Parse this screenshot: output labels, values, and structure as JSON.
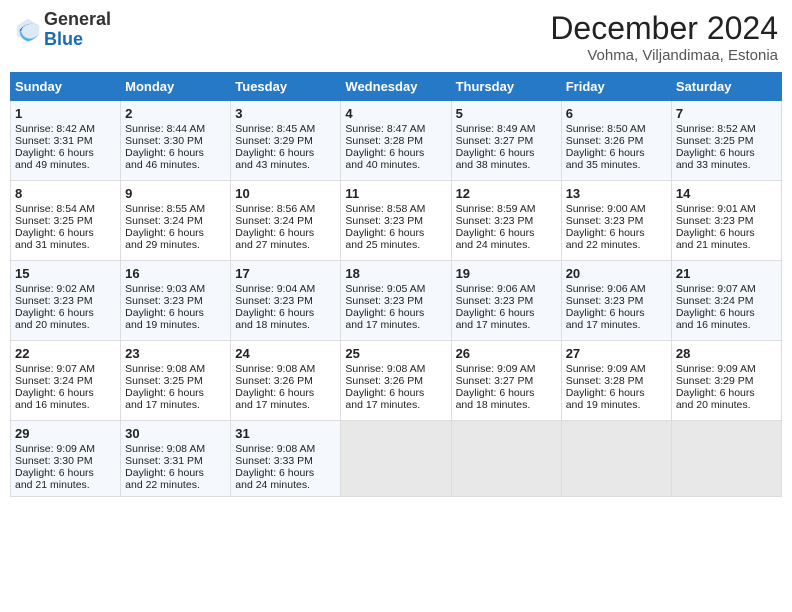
{
  "header": {
    "logo_general": "General",
    "logo_blue": "Blue",
    "month_title": "December 2024",
    "subtitle": "Vohma, Viljandimaa, Estonia"
  },
  "days_of_week": [
    "Sunday",
    "Monday",
    "Tuesday",
    "Wednesday",
    "Thursday",
    "Friday",
    "Saturday"
  ],
  "weeks": [
    [
      {
        "day": 1,
        "lines": [
          "Sunrise: 8:42 AM",
          "Sunset: 3:31 PM",
          "Daylight: 6 hours",
          "and 49 minutes."
        ]
      },
      {
        "day": 2,
        "lines": [
          "Sunrise: 8:44 AM",
          "Sunset: 3:30 PM",
          "Daylight: 6 hours",
          "and 46 minutes."
        ]
      },
      {
        "day": 3,
        "lines": [
          "Sunrise: 8:45 AM",
          "Sunset: 3:29 PM",
          "Daylight: 6 hours",
          "and 43 minutes."
        ]
      },
      {
        "day": 4,
        "lines": [
          "Sunrise: 8:47 AM",
          "Sunset: 3:28 PM",
          "Daylight: 6 hours",
          "and 40 minutes."
        ]
      },
      {
        "day": 5,
        "lines": [
          "Sunrise: 8:49 AM",
          "Sunset: 3:27 PM",
          "Daylight: 6 hours",
          "and 38 minutes."
        ]
      },
      {
        "day": 6,
        "lines": [
          "Sunrise: 8:50 AM",
          "Sunset: 3:26 PM",
          "Daylight: 6 hours",
          "and 35 minutes."
        ]
      },
      {
        "day": 7,
        "lines": [
          "Sunrise: 8:52 AM",
          "Sunset: 3:25 PM",
          "Daylight: 6 hours",
          "and 33 minutes."
        ]
      }
    ],
    [
      {
        "day": 8,
        "lines": [
          "Sunrise: 8:54 AM",
          "Sunset: 3:25 PM",
          "Daylight: 6 hours",
          "and 31 minutes."
        ]
      },
      {
        "day": 9,
        "lines": [
          "Sunrise: 8:55 AM",
          "Sunset: 3:24 PM",
          "Daylight: 6 hours",
          "and 29 minutes."
        ]
      },
      {
        "day": 10,
        "lines": [
          "Sunrise: 8:56 AM",
          "Sunset: 3:24 PM",
          "Daylight: 6 hours",
          "and 27 minutes."
        ]
      },
      {
        "day": 11,
        "lines": [
          "Sunrise: 8:58 AM",
          "Sunset: 3:23 PM",
          "Daylight: 6 hours",
          "and 25 minutes."
        ]
      },
      {
        "day": 12,
        "lines": [
          "Sunrise: 8:59 AM",
          "Sunset: 3:23 PM",
          "Daylight: 6 hours",
          "and 24 minutes."
        ]
      },
      {
        "day": 13,
        "lines": [
          "Sunrise: 9:00 AM",
          "Sunset: 3:23 PM",
          "Daylight: 6 hours",
          "and 22 minutes."
        ]
      },
      {
        "day": 14,
        "lines": [
          "Sunrise: 9:01 AM",
          "Sunset: 3:23 PM",
          "Daylight: 6 hours",
          "and 21 minutes."
        ]
      }
    ],
    [
      {
        "day": 15,
        "lines": [
          "Sunrise: 9:02 AM",
          "Sunset: 3:23 PM",
          "Daylight: 6 hours",
          "and 20 minutes."
        ]
      },
      {
        "day": 16,
        "lines": [
          "Sunrise: 9:03 AM",
          "Sunset: 3:23 PM",
          "Daylight: 6 hours",
          "and 19 minutes."
        ]
      },
      {
        "day": 17,
        "lines": [
          "Sunrise: 9:04 AM",
          "Sunset: 3:23 PM",
          "Daylight: 6 hours",
          "and 18 minutes."
        ]
      },
      {
        "day": 18,
        "lines": [
          "Sunrise: 9:05 AM",
          "Sunset: 3:23 PM",
          "Daylight: 6 hours",
          "and 17 minutes."
        ]
      },
      {
        "day": 19,
        "lines": [
          "Sunrise: 9:06 AM",
          "Sunset: 3:23 PM",
          "Daylight: 6 hours",
          "and 17 minutes."
        ]
      },
      {
        "day": 20,
        "lines": [
          "Sunrise: 9:06 AM",
          "Sunset: 3:23 PM",
          "Daylight: 6 hours",
          "and 17 minutes."
        ]
      },
      {
        "day": 21,
        "lines": [
          "Sunrise: 9:07 AM",
          "Sunset: 3:24 PM",
          "Daylight: 6 hours",
          "and 16 minutes."
        ]
      }
    ],
    [
      {
        "day": 22,
        "lines": [
          "Sunrise: 9:07 AM",
          "Sunset: 3:24 PM",
          "Daylight: 6 hours",
          "and 16 minutes."
        ]
      },
      {
        "day": 23,
        "lines": [
          "Sunrise: 9:08 AM",
          "Sunset: 3:25 PM",
          "Daylight: 6 hours",
          "and 17 minutes."
        ]
      },
      {
        "day": 24,
        "lines": [
          "Sunrise: 9:08 AM",
          "Sunset: 3:26 PM",
          "Daylight: 6 hours",
          "and 17 minutes."
        ]
      },
      {
        "day": 25,
        "lines": [
          "Sunrise: 9:08 AM",
          "Sunset: 3:26 PM",
          "Daylight: 6 hours",
          "and 17 minutes."
        ]
      },
      {
        "day": 26,
        "lines": [
          "Sunrise: 9:09 AM",
          "Sunset: 3:27 PM",
          "Daylight: 6 hours",
          "and 18 minutes."
        ]
      },
      {
        "day": 27,
        "lines": [
          "Sunrise: 9:09 AM",
          "Sunset: 3:28 PM",
          "Daylight: 6 hours",
          "and 19 minutes."
        ]
      },
      {
        "day": 28,
        "lines": [
          "Sunrise: 9:09 AM",
          "Sunset: 3:29 PM",
          "Daylight: 6 hours",
          "and 20 minutes."
        ]
      }
    ],
    [
      {
        "day": 29,
        "lines": [
          "Sunrise: 9:09 AM",
          "Sunset: 3:30 PM",
          "Daylight: 6 hours",
          "and 21 minutes."
        ]
      },
      {
        "day": 30,
        "lines": [
          "Sunrise: 9:08 AM",
          "Sunset: 3:31 PM",
          "Daylight: 6 hours",
          "and 22 minutes."
        ]
      },
      {
        "day": 31,
        "lines": [
          "Sunrise: 9:08 AM",
          "Sunset: 3:33 PM",
          "Daylight: 6 hours",
          "and 24 minutes."
        ]
      },
      null,
      null,
      null,
      null
    ]
  ]
}
